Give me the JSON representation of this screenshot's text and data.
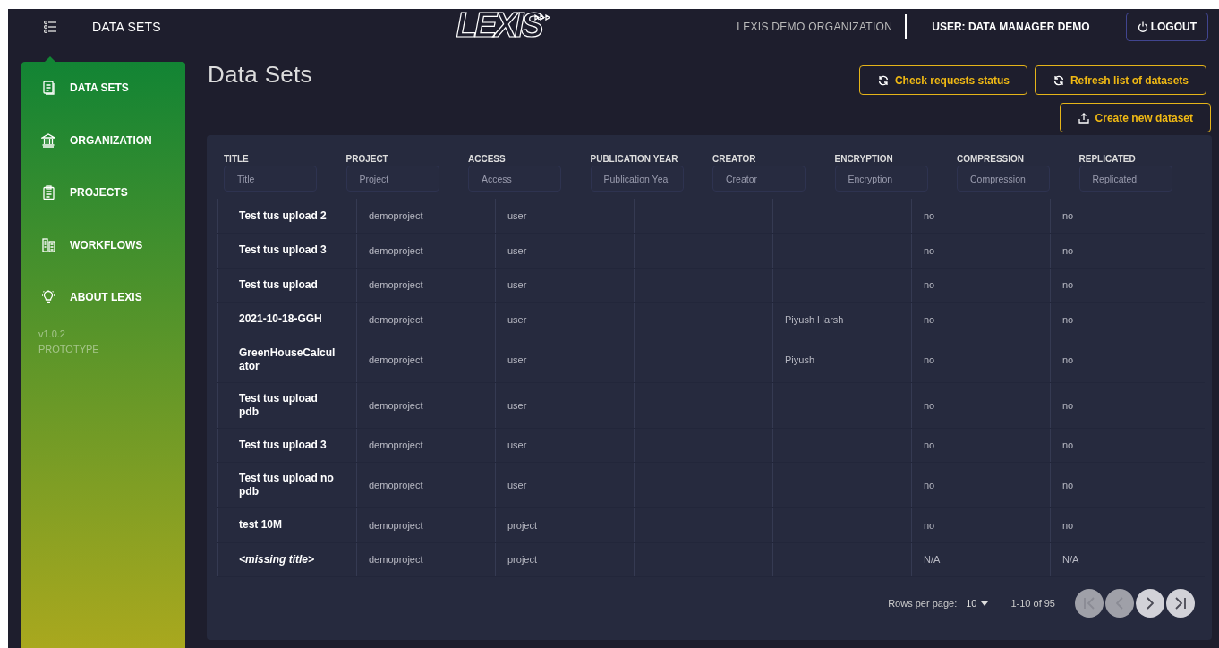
{
  "topbar": {
    "menu_title": "DATA SETS",
    "logo": "LEXIS",
    "organization": "LEXIS DEMO ORGANIZATION",
    "user": "USER: DATA MANAGER DEMO",
    "logout": "LOGOUT"
  },
  "sidebar": {
    "items": [
      {
        "label": "DATA SETS"
      },
      {
        "label": "ORGANIZATION"
      },
      {
        "label": "PROJECTS"
      },
      {
        "label": "WORKFLOWS"
      },
      {
        "label": "ABOUT LEXIS"
      }
    ],
    "version": "v1.0.2",
    "stage": "PROTOTYPE"
  },
  "page": {
    "title": "Data Sets",
    "actions": [
      {
        "label": "Check requests status",
        "kind": "refresh"
      },
      {
        "label": "Refresh list of datasets",
        "kind": "refresh"
      },
      {
        "label": "Create new dataset",
        "kind": "upload"
      }
    ]
  },
  "table": {
    "columns": [
      {
        "label": "TITLE",
        "placeholder": "Title"
      },
      {
        "label": "PROJECT",
        "placeholder": "Project"
      },
      {
        "label": "ACCESS",
        "placeholder": "Access"
      },
      {
        "label": "PUBLICATION YEAR",
        "placeholder": "Publication Yea"
      },
      {
        "label": "CREATOR",
        "placeholder": "Creator"
      },
      {
        "label": "ENCRYPTION",
        "placeholder": "Encryption"
      },
      {
        "label": "COMPRESSION",
        "placeholder": "Compression"
      },
      {
        "label": "REPLICATED",
        "placeholder": "Replicated"
      }
    ],
    "rows": [
      {
        "title": "Test tus upload 2",
        "missing": false,
        "project": "demoproject",
        "access": "user",
        "encryption": "no",
        "compression": "no"
      },
      {
        "title": "Test tus upload 3",
        "missing": false,
        "project": "demoproject",
        "access": "user",
        "encryption": "no",
        "compression": "no"
      },
      {
        "title": "Test tus upload",
        "missing": false,
        "project": "demoproject",
        "access": "user",
        "encryption": "no",
        "compression": "no"
      },
      {
        "title": "2021-10-18-GGH",
        "missing": false,
        "project": "demoproject",
        "access": "user",
        "creator": "Piyush Harsh",
        "encryption": "no",
        "compression": "no"
      },
      {
        "title": "GreenHouseCalcul ator",
        "missing": false,
        "project": "demoproject",
        "access": "user",
        "creator": "Piyush",
        "encryption": "no",
        "compression": "no"
      },
      {
        "title": "Test tus upload pdb",
        "missing": false,
        "project": "demoproject",
        "access": "user",
        "encryption": "no",
        "compression": "no"
      },
      {
        "title": "Test tus upload 3",
        "missing": false,
        "project": "demoproject",
        "access": "user",
        "encryption": "no",
        "compression": "no"
      },
      {
        "title": "Test tus upload no pdb",
        "missing": false,
        "project": "demoproject",
        "access": "user",
        "encryption": "no",
        "compression": "no"
      },
      {
        "title": "test 10M",
        "missing": false,
        "project": "demoproject",
        "access": "project",
        "encryption": "no",
        "compression": "no"
      },
      {
        "title": "<missing title>",
        "missing": true,
        "project": "demoproject",
        "access": "project",
        "encryption": "N/A",
        "compression": "N/A"
      }
    ]
  },
  "pagination": {
    "rows_per_page_label": "Rows per page:",
    "rows_per_page": "10",
    "range": "1-10 of 95",
    "buttons": [
      {
        "kind": "first",
        "disabled": true
      },
      {
        "kind": "prev",
        "disabled": true
      },
      {
        "kind": "next",
        "disabled": false
      },
      {
        "kind": "last",
        "disabled": false
      }
    ]
  }
}
